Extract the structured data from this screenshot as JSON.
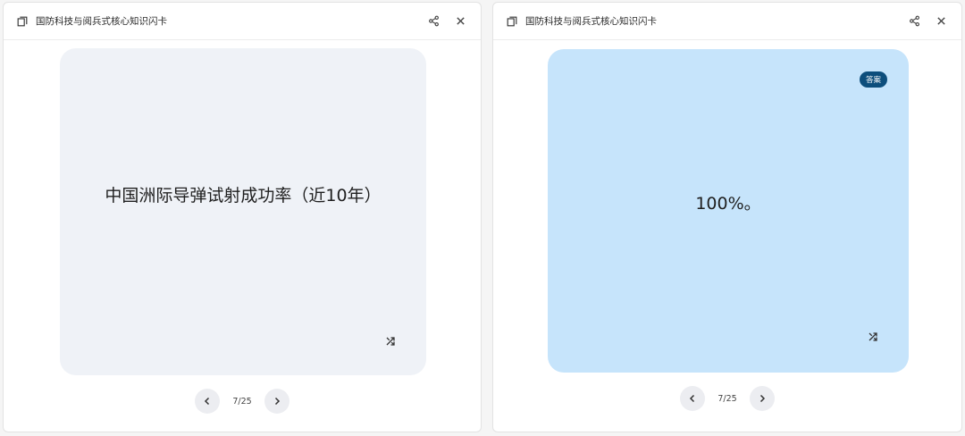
{
  "deck_title": "国防科技与阅兵式核心知识闪卡",
  "left_panel": {
    "card_text": "中国洲际导弹试射成功率（近10年）",
    "counter": "7/25"
  },
  "right_panel": {
    "badge": "答案",
    "card_text": "100%。",
    "counter": "7/25"
  },
  "colors": {
    "question_card_bg": "#eff2f7",
    "answer_card_bg": "#c6e4fb",
    "badge_bg": "#0d4e7c"
  },
  "icons": [
    "deck-icon",
    "share-icon",
    "close-icon",
    "flip-icon",
    "chevron-left-icon",
    "chevron-right-icon"
  ]
}
